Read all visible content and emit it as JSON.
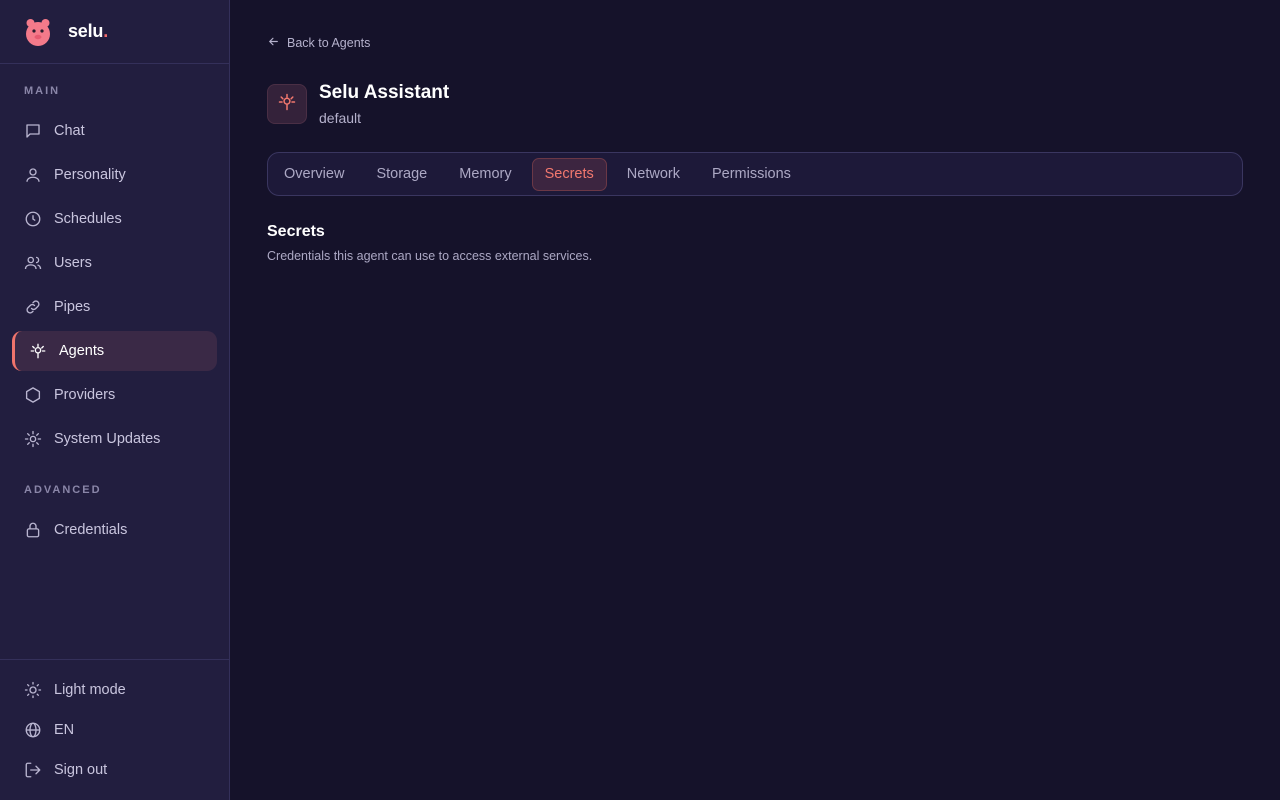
{
  "brand": {
    "name": "selu",
    "dot": "."
  },
  "sidebar": {
    "main_label": "MAIN",
    "advanced_label": "ADVANCED",
    "main_items": [
      {
        "label": "Chat",
        "icon": "chat-icon"
      },
      {
        "label": "Personality",
        "icon": "user-icon"
      },
      {
        "label": "Schedules",
        "icon": "clock-icon"
      },
      {
        "label": "Users",
        "icon": "users-icon"
      },
      {
        "label": "Pipes",
        "icon": "link-icon"
      },
      {
        "label": "Agents",
        "icon": "agent-icon",
        "active": true
      },
      {
        "label": "Providers",
        "icon": "hexagon-icon"
      },
      {
        "label": "System Updates",
        "icon": "gear-icon"
      }
    ],
    "advanced_items": [
      {
        "label": "Credentials",
        "icon": "lock-icon"
      }
    ],
    "footer_items": [
      {
        "label": "Light mode",
        "icon": "sun-icon"
      },
      {
        "label": "EN",
        "icon": "globe-icon"
      },
      {
        "label": "Sign out",
        "icon": "sign-out-icon"
      }
    ]
  },
  "main": {
    "back_label": "Back to Agents",
    "agent_name": "Selu Assistant",
    "agent_subtitle": "default",
    "tabs": [
      {
        "label": "Overview"
      },
      {
        "label": "Storage"
      },
      {
        "label": "Memory"
      },
      {
        "label": "Secrets",
        "active": true
      },
      {
        "label": "Network"
      },
      {
        "label": "Permissions"
      }
    ],
    "section_title": "Secrets",
    "section_description": "Credentials this agent can use to access external services."
  },
  "colors": {
    "background": "#15122a",
    "sidebar": "#221e3f",
    "accent": "#f2786e",
    "active_bg": "#3a2946"
  }
}
